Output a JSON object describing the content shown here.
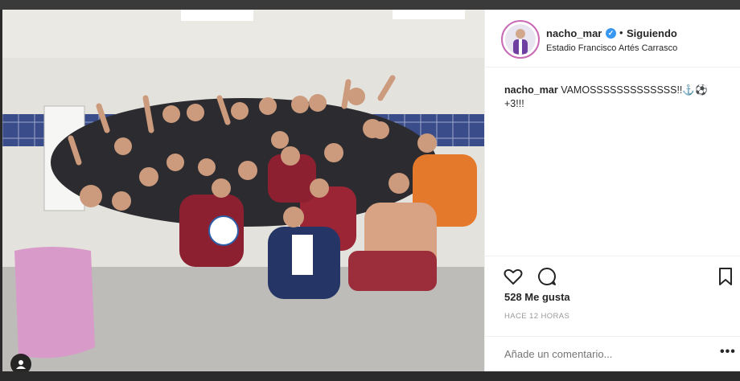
{
  "post": {
    "username": "nacho_mar",
    "follow_label": "Siguiendo",
    "dot": "•",
    "location": "Estadio Francisco Artés Carrasco",
    "caption_user": "nacho_mar",
    "caption_text": "VAMOSSSSSSSSSSSSS!!⚓⚽",
    "caption_line2": "+3!!!",
    "likes": "528 Me gusta",
    "time": "HACE 12 HORAS",
    "comment_placeholder": "Añade un comentario...",
    "more": "•••"
  },
  "colors": {
    "accent": "#3897f0",
    "text": "#262626",
    "muted": "#999999"
  },
  "icons": [
    "heart-icon",
    "comment-icon",
    "bookmark-icon",
    "user-tag-icon",
    "verified-icon"
  ]
}
